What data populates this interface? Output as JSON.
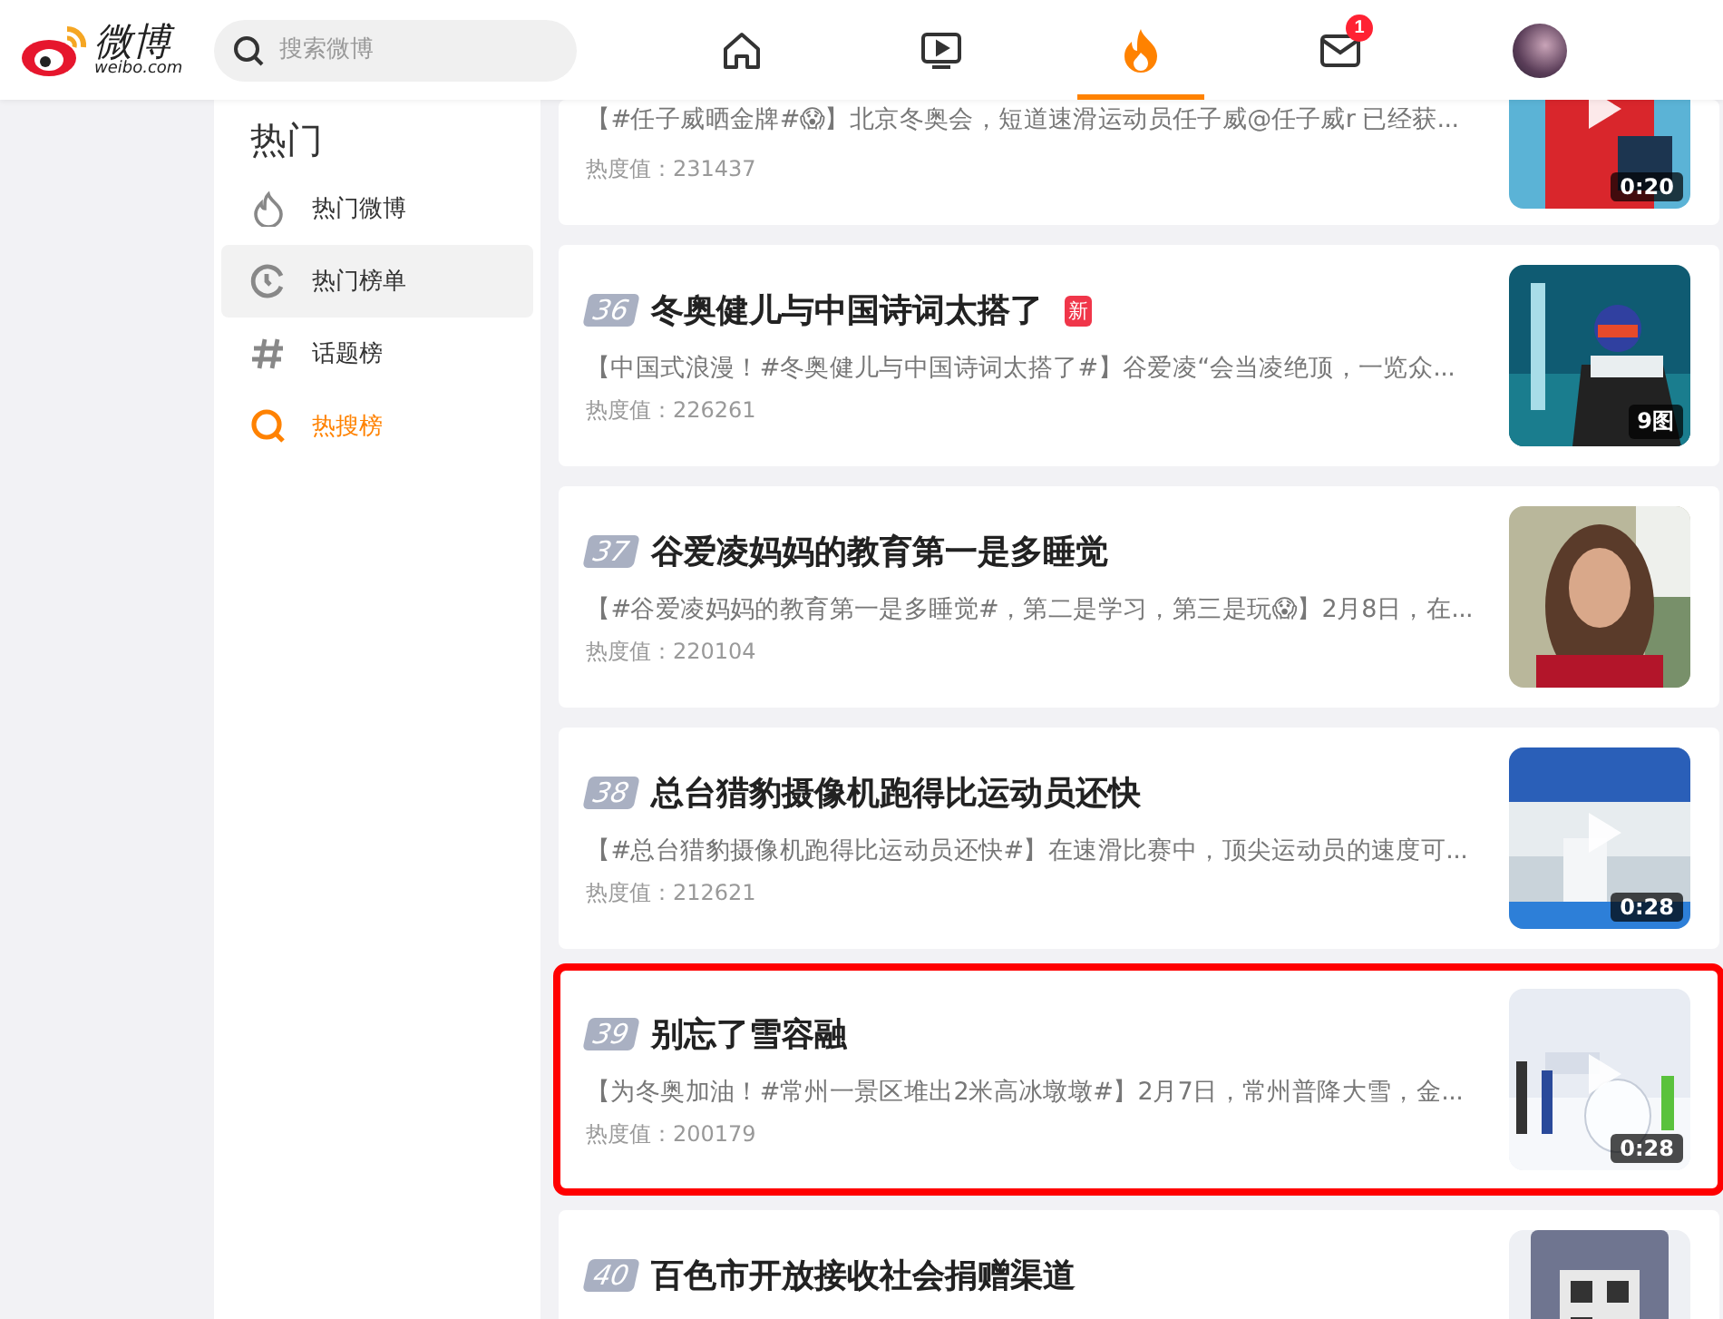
{
  "header": {
    "logo": {
      "name": "微博",
      "domain": "weibo.com"
    },
    "search": {
      "placeholder": "搜索微博"
    },
    "nav": [
      {
        "kind": "home",
        "selected": false
      },
      {
        "kind": "video",
        "selected": false
      },
      {
        "kind": "fire",
        "selected": true
      },
      {
        "kind": "mail",
        "selected": false,
        "badge": "1"
      },
      {
        "kind": "avatar",
        "selected": false
      }
    ]
  },
  "sidebar": {
    "title": "热门",
    "items": [
      {
        "kind": "flame",
        "label": "热门微博",
        "selected": false,
        "highlighted": false
      },
      {
        "kind": "clock",
        "label": "热门榜单",
        "selected": false,
        "highlighted": true
      },
      {
        "kind": "hash",
        "label": "话题榜",
        "selected": false,
        "highlighted": false
      },
      {
        "kind": "search",
        "label": "热搜榜",
        "selected": true,
        "highlighted": false
      }
    ]
  },
  "feed": [
    {
      "excerpt": "【#任子威晒金牌#😱】北京冬奥会，短道速滑运动员任子威@任子威r 已经获...",
      "heat": "热度值：231437",
      "media": {
        "kind": "video",
        "overlay": "0:20"
      },
      "outlined": false
    },
    {
      "rank": "36",
      "title": "冬奥健儿与中国诗词太搭了",
      "tag": "新",
      "excerpt": "【中国式浪漫！#冬奥健儿与中国诗词太搭了#】谷爱凌“会当凌绝顶，一览众...",
      "heat": "热度值：226261",
      "media": {
        "kind": "gallery",
        "overlay": "9图"
      },
      "outlined": false
    },
    {
      "rank": "37",
      "title": "谷爱凌妈妈的教育第一是多睡觉",
      "excerpt": "【#谷爱凌妈妈的教育第一是多睡觉#，第二是学习，第三是玩😱】2月8日，在...",
      "heat": "热度值：220104",
      "outlined": false
    },
    {
      "rank": "38",
      "title": "总台猎豹摄像机跑得比运动员还快",
      "excerpt": "【#总台猎豹摄像机跑得比运动员还快#】在速滑比赛中，顶尖运动员的速度可...",
      "heat": "热度值：212621",
      "media": {
        "kind": "video",
        "overlay": "0:28"
      },
      "outlined": false
    },
    {
      "rank": "39",
      "title": "别忘了雪容融",
      "excerpt": "【为冬奥加油！#常州一景区堆出2米高冰墩墩#】2月7日，常州普降大雪，金...",
      "heat": "热度值：200179",
      "media": {
        "kind": "video",
        "overlay": "0:28"
      },
      "outlined": true
    },
    {
      "rank": "40",
      "title": "百色市开放接收社会捐赠渠道",
      "outlined": false
    }
  ]
}
